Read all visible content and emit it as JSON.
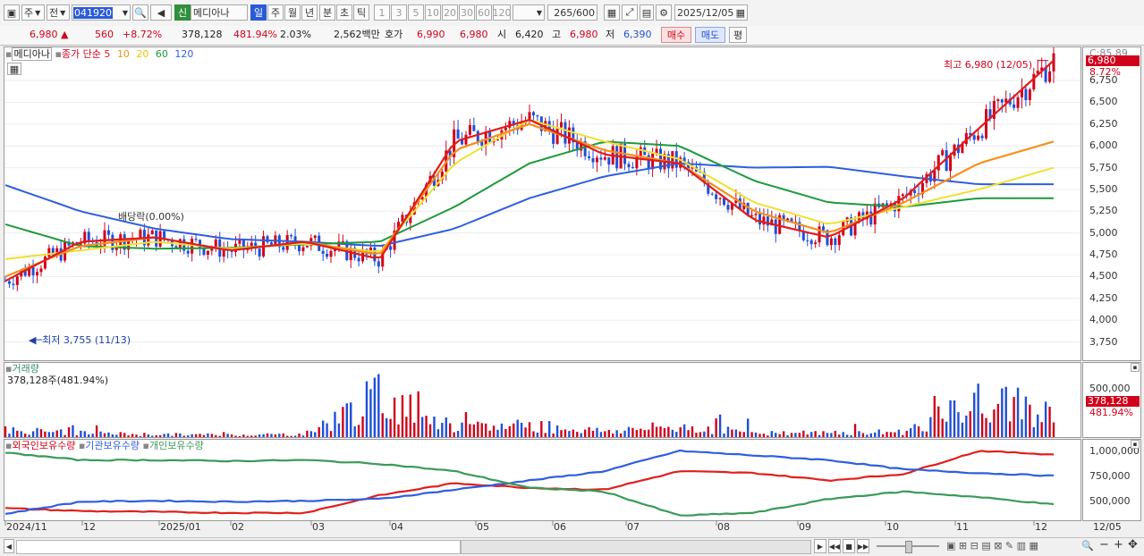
{
  "toolbar": {
    "market": "주",
    "prev": "전",
    "code": "041920",
    "name": "메디아나",
    "shin": "신",
    "periods": [
      "일",
      "주",
      "월",
      "년",
      "분",
      "초",
      "틱"
    ],
    "steps": [
      "1",
      "3",
      "5",
      "10",
      "20",
      "30",
      "60",
      "120"
    ],
    "count": "265",
    "total": "/600",
    "date": "2025/12/05"
  },
  "info": {
    "price": "6,980",
    "change": "560",
    "rate": "+8.72%",
    "volume": "378,128",
    "vol_ratio": "481.94%",
    "turnover": "2.03%",
    "amount": "2,562백만",
    "hoga_label": "호가",
    "hoga_sell": "6,990",
    "hoga_buy": "6,980",
    "open_label": "시",
    "open": "6,420",
    "high_label": "고",
    "high": "6,980",
    "low_label": "저",
    "low": "6,390",
    "buy": "매수",
    "sell": "매도",
    "eval": "평"
  },
  "price_pane": {
    "name": "메디아나",
    "ma_prefix": "종가 단순",
    "ma": [
      "5",
      "10",
      "20",
      "60",
      "120"
    ],
    "max_label": "최고 6,980 (12/05)",
    "min_label": "최저 3,755 (11/13)",
    "div_label": "배당락(0.00%)",
    "axis_top": "C:85.89",
    "current": "6,980",
    "current_rate": "8.72%"
  },
  "volume_pane": {
    "title": "거래량",
    "value": "378,128주(481.94%)",
    "current": "378,128",
    "current_rate": "481.94%"
  },
  "holder_pane": {
    "series": [
      "외국인보유수량",
      "기관보유수량",
      "개인보유수량"
    ]
  },
  "xaxis": [
    "2024/11",
    "12",
    "2025/01",
    "02",
    "03",
    "04",
    "05",
    "06",
    "07",
    "08",
    "09",
    "10",
    "11",
    "12"
  ],
  "xaxis_last": "12/05",
  "colors": {
    "up": "#d0021b",
    "down": "#1f4fd8",
    "ma5": "#e01b1b",
    "ma10": "#f5901e",
    "ma20": "#f0e030",
    "ma60": "#1e9a3c",
    "ma120": "#2f5fe0",
    "foreign": "#e0201c",
    "inst": "#2f5fe0",
    "indiv": "#3a9a5a"
  },
  "chart_data": [
    {
      "type": "line",
      "title": "메디아나",
      "ylim": [
        3550,
        7100
      ],
      "yticks": [
        "6,750",
        "6,500",
        "6,250",
        "6,000",
        "5,750",
        "5,500",
        "5,250",
        "5,000",
        "4,750",
        "4,500",
        "4,250",
        "4,000",
        "3,750"
      ],
      "x": [
        "2024/11",
        "12",
        "2025/01",
        "02",
        "03",
        "04",
        "05",
        "06",
        "07",
        "08",
        "09",
        "10",
        "11",
        "12",
        "12/05"
      ],
      "series": [
        {
          "name": "5",
          "values": [
            4450,
            4900,
            4950,
            4800,
            4900,
            4700,
            6050,
            6300,
            5900,
            5800,
            5150,
            4950,
            5400,
            6200,
            6980
          ]
        },
        {
          "name": "10",
          "values": [
            4500,
            4850,
            4950,
            4800,
            4900,
            4750,
            5950,
            6250,
            5950,
            5800,
            5250,
            5000,
            5350,
            5800,
            6050
          ]
        },
        {
          "name": "20",
          "values": [
            4700,
            4800,
            4900,
            4820,
            4880,
            4780,
            5800,
            6300,
            6050,
            5850,
            5350,
            5100,
            5300,
            5500,
            5750
          ]
        },
        {
          "name": "60",
          "values": [
            5100,
            4850,
            4820,
            4830,
            4870,
            4900,
            5300,
            5800,
            6050,
            6000,
            5600,
            5350,
            5300,
            5400,
            5400
          ]
        },
        {
          "name": "120",
          "values": [
            5550,
            5250,
            5050,
            4930,
            4900,
            4850,
            5050,
            5400,
            5650,
            5800,
            5750,
            5760,
            5650,
            5560,
            5560
          ]
        }
      ]
    },
    {
      "type": "bar",
      "title": "거래량",
      "ylim": [
        0,
        700000
      ],
      "yticks": [
        "500,000"
      ],
      "x": [
        "2024/11",
        "12",
        "2025/01",
        "02",
        "03",
        "04",
        "05",
        "06",
        "07",
        "08",
        "09",
        "10",
        "11",
        "12",
        "12/05"
      ],
      "values": [
        110000,
        60000,
        40000,
        35000,
        45000,
        620000,
        130000,
        180000,
        90000,
        160000,
        70000,
        60000,
        80000,
        520000,
        378128
      ]
    },
    {
      "type": "line",
      "ylim": [
        250000,
        1100000
      ],
      "yticks": [
        "1,000,000",
        "750,000",
        "500,000"
      ],
      "x": [
        "2024/11",
        "12",
        "2025/01",
        "02",
        "03",
        "04",
        "05",
        "06",
        "07",
        "08",
        "09",
        "10",
        "11",
        "12",
        "12/05"
      ],
      "series": [
        {
          "name": "외국인보유수량",
          "values": [
            380000,
            350000,
            340000,
            330000,
            330000,
            520000,
            650000,
            600000,
            580000,
            780000,
            760000,
            680000,
            750000,
            1000000,
            960000
          ]
        },
        {
          "name": "기관보유수량",
          "values": [
            320000,
            450000,
            460000,
            450000,
            460000,
            480000,
            580000,
            680000,
            780000,
            1000000,
            950000,
            900000,
            800000,
            760000,
            730000
          ]
        },
        {
          "name": "개인보유수량",
          "values": [
            980000,
            900000,
            900000,
            890000,
            900000,
            860000,
            780000,
            600000,
            560000,
            300000,
            330000,
            480000,
            560000,
            500000,
            420000
          ]
        }
      ]
    }
  ]
}
